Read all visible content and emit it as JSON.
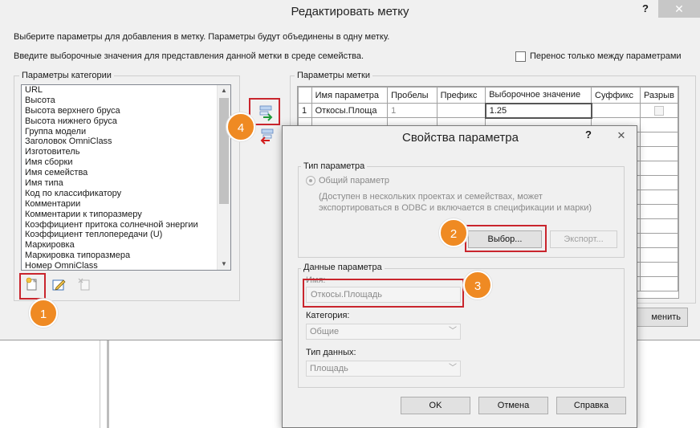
{
  "main": {
    "title": "Редактировать метку",
    "help": "?",
    "close": "✕",
    "instruction1": "Выберите параметры для добавления в метку.  Параметры будут объединены в одну метку.",
    "instruction2": "Введите выборочные значения для представления данной метки в среде семейства.",
    "transfer_label": "Перенос только между параметрами",
    "category_group": "Параметры категории",
    "category_items": [
      "URL",
      "Высота",
      "Высота верхнего бруса",
      "Высота нижнего бруса",
      "Группа модели",
      "Заголовок OmniClass",
      "Изготовитель",
      "Имя сборки",
      "Имя семейства",
      "Имя типа",
      "Код по классификатору",
      "Комментарии",
      "Комментарии к типоразмеру",
      "Коэффициент притока солнечной энергии",
      "Коэффициент теплопередачи (U)",
      "Маркировка",
      "Маркировка типоразмера",
      "Номер OmniClass"
    ],
    "label_group": "Параметры метки",
    "table_headers": [
      "",
      "Имя параметра",
      "Пробелы",
      "Префикс",
      "Выборочное значение",
      "Суффикс",
      "Разрыв"
    ],
    "table_row": {
      "num": "1",
      "name": "Откосы.Площа",
      "spaces": "1",
      "prefix": "",
      "sample": "1.25",
      "suffix": ""
    },
    "apply_label": "менить"
  },
  "prop": {
    "title": "Свойства параметра",
    "help": "?",
    "close": "✕",
    "type_group": "Тип параметра",
    "shared_param": "Общий параметр",
    "desc_line1": "(Доступен в нескольких проектах и семействах, может",
    "desc_line2": "экспортироваться в ODBC и включается в спецификации и марки)",
    "select_btn": "Выбор...",
    "export_btn": "Экспорт...",
    "data_group": "Данные параметра",
    "name_label": "Имя:",
    "name_value": "Откосы.Площадь",
    "category_label": "Категория:",
    "category_value": "Общие",
    "datatype_label": "Тип данных:",
    "datatype_value": "Площадь",
    "ok": "OK",
    "cancel": "Отмена",
    "help_btn": "Справка"
  },
  "badges": [
    "1",
    "2",
    "3",
    "4"
  ],
  "colors": {
    "highlight": "#c9252d",
    "badge": "#ef8a23"
  },
  "icons": [
    "new-parameter-icon",
    "edit-parameter-icon",
    "delete-parameter-icon",
    "add-to-label-icon",
    "remove-from-label-icon"
  ]
}
